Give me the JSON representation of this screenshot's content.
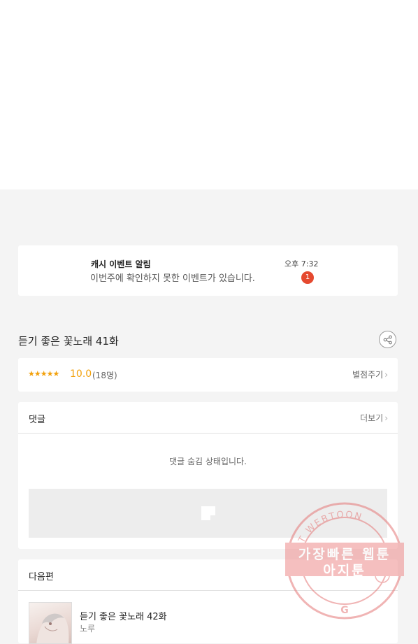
{
  "notification": {
    "title": "캐시 이벤트 알림",
    "message": "이번주에 확인하지 못한 이벤트가 있습니다.",
    "time": "오후 7:32",
    "badge_count": "1"
  },
  "episode": {
    "title": "듣기 좋은 꽃노래 41화",
    "share_icon": "share-icon"
  },
  "rating": {
    "stars": "★★★★★",
    "score": "10.0",
    "count": "(18명)",
    "rate_label": "별점주기",
    "accent_color": "#f2a10c"
  },
  "comments": {
    "header": "댓글",
    "more_label": "더보기",
    "hidden_message": "댓글 숨김 상태입니다."
  },
  "next": {
    "header": "다음편",
    "title": "듣기 좋은 꽃노래 42화",
    "author": "노루"
  },
  "watermark": {
    "line1": "가장빠른 웹툰",
    "line2": "아지툰",
    "ring_text": "AGIT WEBTOON",
    "color": "#e57777"
  },
  "colors": {
    "badge": "#e5492f",
    "page_background": "#f4f4f4"
  }
}
